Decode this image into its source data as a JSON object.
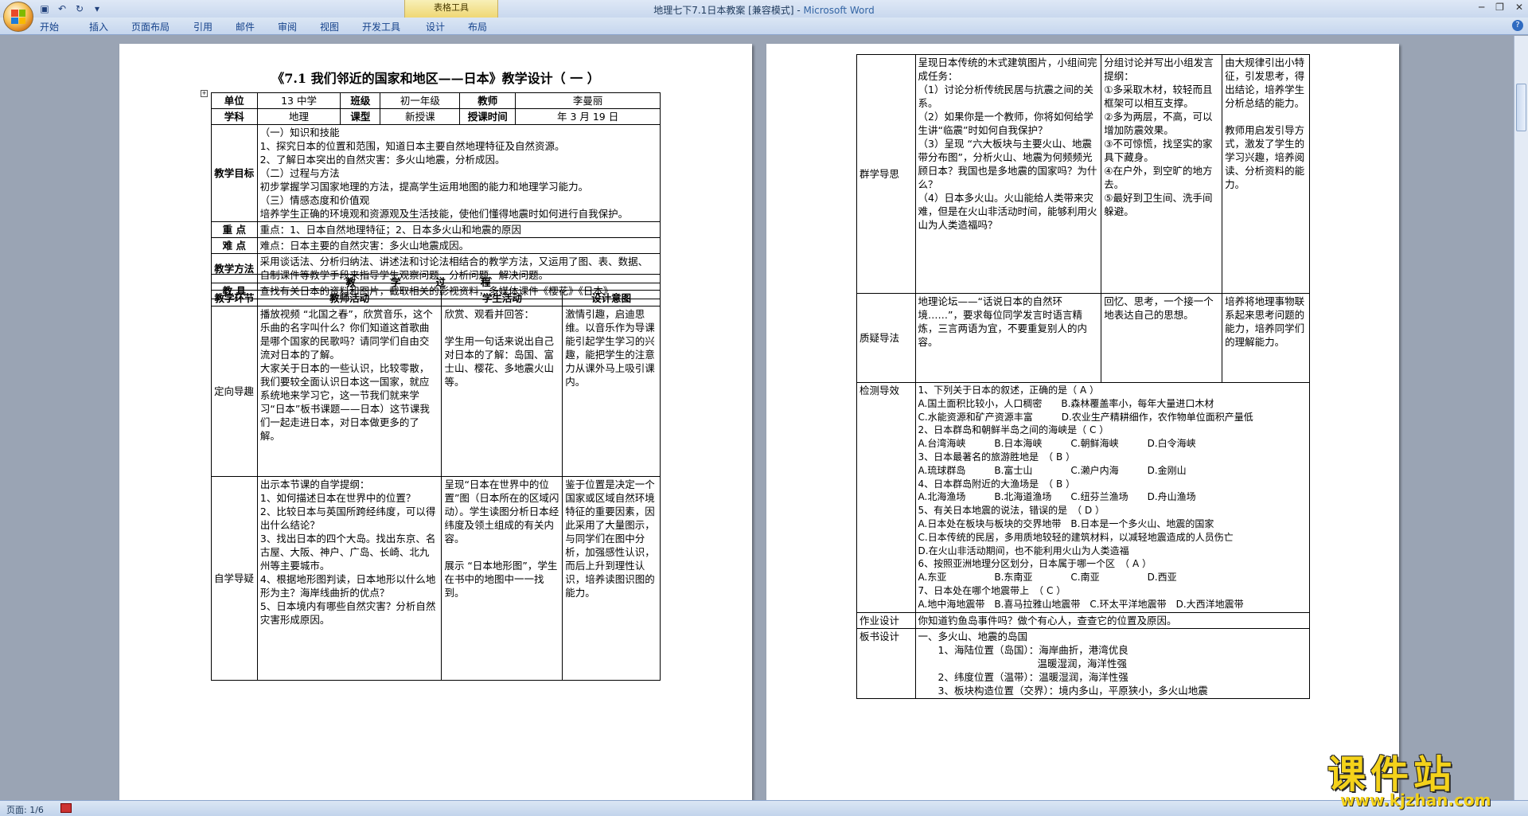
{
  "window": {
    "title": "地理七下7.1日本教案 [兼容模式]",
    "app_name": "Microsoft Word",
    "context_tools": "表格工具"
  },
  "ribbon": {
    "tabs": [
      "开始",
      "插入",
      "页面布局",
      "引用",
      "邮件",
      "审阅",
      "视图",
      "开发工具",
      "设计",
      "布局"
    ]
  },
  "status": {
    "page": "页面: 1/6"
  },
  "doc": {
    "title": "《7.1 我们邻近的国家和地区——日本》教学设计（ 一 ）",
    "info": {
      "unit_label": "单位",
      "unit": "13 中学",
      "class_label": "班级",
      "class": "初一年级",
      "teacher_label": "教师",
      "teacher": "李曼丽",
      "subject_label": "学科",
      "subject": "地理",
      "type_label": "课型",
      "type": "新授课",
      "time_label": "授课时间",
      "time": "年 3 月 19 日"
    },
    "goals": {
      "label": "教学目标",
      "text": "（一）知识和技能\n1、探究日本的位置和范围，知道日本主要自然地理特征及自然资源。\n2、了解日本突出的自然灾害：多火山地震，分析成因。\n（二）过程与方法\n初步掌握学习国家地理的方法，提高学生运用地图的能力和地理学习能力。\n（三）情感态度和价值观\n培养学生正确的环境观和资源观及生活技能，使他们懂得地震时如何进行自我保护。"
    },
    "keys": {
      "key_label": "重 点",
      "key": "重点：1、日本自然地理特征；2、日本多火山和地震的原因",
      "hard_label": "难 点",
      "hard": "难点：日本主要的自然灾害：多火山地震成因。"
    },
    "method": {
      "label": "教学方法",
      "text": "采用谈话法、分析归纳法、讲述法和讨论法相结合的教学方法，又运用了图、表、数据、自制课件等教学手段来指导学生观察问题、分析问题、解决问题。"
    },
    "tools": {
      "label": "教 具",
      "text": "查找有关日本的资料和图片，截取相关的影视资料，多媒体课件《樱花》《日本》"
    },
    "process": {
      "heading": "教学过程",
      "headers": [
        "教学环节",
        "教师活动",
        "学生活动",
        "设计意图"
      ],
      "rows": [
        {
          "stage": "定向导趣",
          "teacher": "播放视频 “北国之春”，欣赏音乐，这个乐曲的名字叫什么？你们知道这首歌曲是哪个国家的民歌吗？请同学们自由交流对日本的了解。\n大家关于日本的一些认识，比较零散，我们要较全面认识日本这一国家，就应系统地来学习它，这一节我们就来学习“日本”板书课题——日本）这节课我们一起走进日本，对日本做更多的了解。",
          "student": "欣赏、观看并回答：\n\n学生用一句话来说出自己对日本的了解：岛国、富士山、樱花、多地震火山等。",
          "intent": "激情引趣，启迪思维。以音乐作为导课能引起学生学习的兴趣，能把学生的注意力从课外马上吸引课内。"
        },
        {
          "stage": "自学导疑",
          "teacher": "出示本节课的自学提纲：\n1、如何描述日本在世界中的位置？\n2、比较日本与英国所跨经纬度，可以得出什么结论？\n3、找出日本的四个大岛。找出东京、名古屋、大阪、神户、广岛、长崎、北九州等主要城市。\n4、根据地形图判读，日本地形以什么地形为主？海岸线曲折的优点？\n5、日本境内有哪些自然灾害？分析自然灾害形成原因。",
          "student": "呈现“日本在世界中的位置”图（日本所在的区域闪动）。学生读图分析日本经纬度及领土组成的有关内容。\n\n展示 “日本地形图”，学生在书中的地图中一一找到。",
          "intent": "鉴于位置是决定一个国家或区域自然环境特征的重要因素，因此采用了大量图示，与同学们在图中分析，加强感性认识，而后上升到理性认识，培养读图识图的能力。"
        }
      ]
    },
    "page2": {
      "rows": [
        {
          "stage": "群学导思",
          "teacher": "呈现日本传统的木式建筑图片，小组间完成任务：\n（1）讨论分析传统民居与抗震之间的关系。\n（2）如果你是一个教师，你将如何给学生讲“临震”时如何自我保护？\n（3）呈现 “六大板块与主要火山、地震带分布图”，分析火山、地震为何频频光顾日本？我国也是多地震的国家吗？为什么？\n（4）日本多火山。火山能给人类带来灾难，但是在火山非活动时间，能够利用火山为人类造福吗？",
          "student": "分组讨论并写出小组发言提纲：\n①多采取木材，较轻而且框架可以相互支撑。\n②多为两层，不高，可以增加防震效果。\n③不可惊慌，找坚实的家具下藏身。\n④在户外，到空旷的地方去。\n⑤最好到卫生间、洗手间躲避。",
          "intent": "由大规律引出小特征，引发思考，得出结论，培养学生分析总结的能力。\n\n教师用启发引导方式，激发了学生的学习兴趣，培养阅读、分析资料的能力。"
        },
        {
          "stage": "质疑导法",
          "teacher": "地理论坛——“话说日本的自然环境……”，要求每位同学发言时语言精炼，三言两语为宜，不要重复别人的内容。",
          "student": "回忆、思考，一个接一个地表达自己的思想。",
          "intent": "培养将地理事物联系起来思考问题的能力，培养同学们的理解能力。"
        }
      ],
      "test": {
        "stage": "检测导效",
        "lines": [
          "1、下列关于日本的叙述，正确的是（ A ）",
          "A.国土面积比较小，人口稠密　　B.森林覆盖率小，每年大量进口木材",
          "C.水能资源和矿产资源丰富　　　D.农业生产精耕细作，农作物单位面积产量低",
          "2、日本群岛和朝鲜半岛之间的海峡是（ C ）",
          "A.台湾海峡　　　B.日本海峡　　　C.朝鲜海峡　　　D.白令海峡",
          "3、日本最著名的旅游胜地是　（ B ）",
          "A.琉球群岛　　　B.富士山　　　　C.濑户内海　　　D.金刚山",
          "4、日本群岛附近的大渔场是　（ B ）",
          "A.北海渔场　　　B.北海道渔场　　C.纽芬兰渔场　　D.舟山渔场",
          "5、有关日本地震的说法，错误的是　（ D ）",
          "A.日本处在板块与板块的交界地带　B.日本是一个多火山、地震的国家",
          "C.日本传统的民居，多用质地较轻的建筑材料，以减轻地震造成的人员伤亡",
          "D.在火山非活动期间，也不能利用火山为人类造福",
          "6、按照亚洲地理分区划分，日本属于哪一个区　（ A ）",
          "A.东亚　　　　　B.东南亚　　　　C.南亚　　　　　D.西亚",
          "7、日本处在哪个地震带上　（ C ）",
          "A.地中海地震带　B.喜马拉雅山地震带　C.环太平洋地震带　D.大西洋地震带"
        ]
      },
      "homework": {
        "stage": "作业设计",
        "text": "你知道钓鱼岛事件吗？做个有心人，查查它的位置及原因。"
      },
      "board": {
        "stage": "板书设计",
        "text": "一、多火山、地震的岛国\n　　1、海陆位置（岛国）：海岸曲折，港湾优良\n　　　　　　　　　　　　温暖湿润，海洋性强\n　　2、纬度位置（温带）：温暖湿润，海洋性强\n　　3、板块构造位置（交界）：境内多山，平原狭小，多火山地震"
      }
    }
  },
  "watermark": {
    "main": "课件站",
    "url": "www.kjzhan.com"
  }
}
